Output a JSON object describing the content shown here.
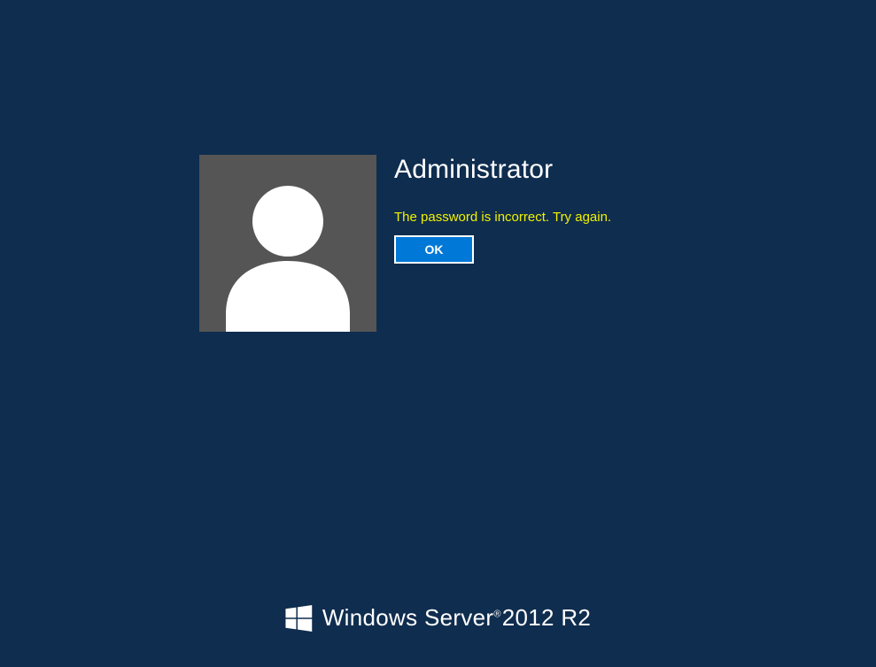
{
  "login": {
    "username": "Administrator",
    "error_message": "The password is incorrect. Try again.",
    "ok_button_label": "OK"
  },
  "branding": {
    "product_name_1": "Windows Server",
    "product_year": "2012",
    "product_suffix": "R2"
  },
  "colors": {
    "background": "#0f2d4e",
    "avatar_bg": "#555555",
    "error_text": "#f2f200",
    "button_bg": "#0078d7",
    "text": "#ffffff"
  }
}
